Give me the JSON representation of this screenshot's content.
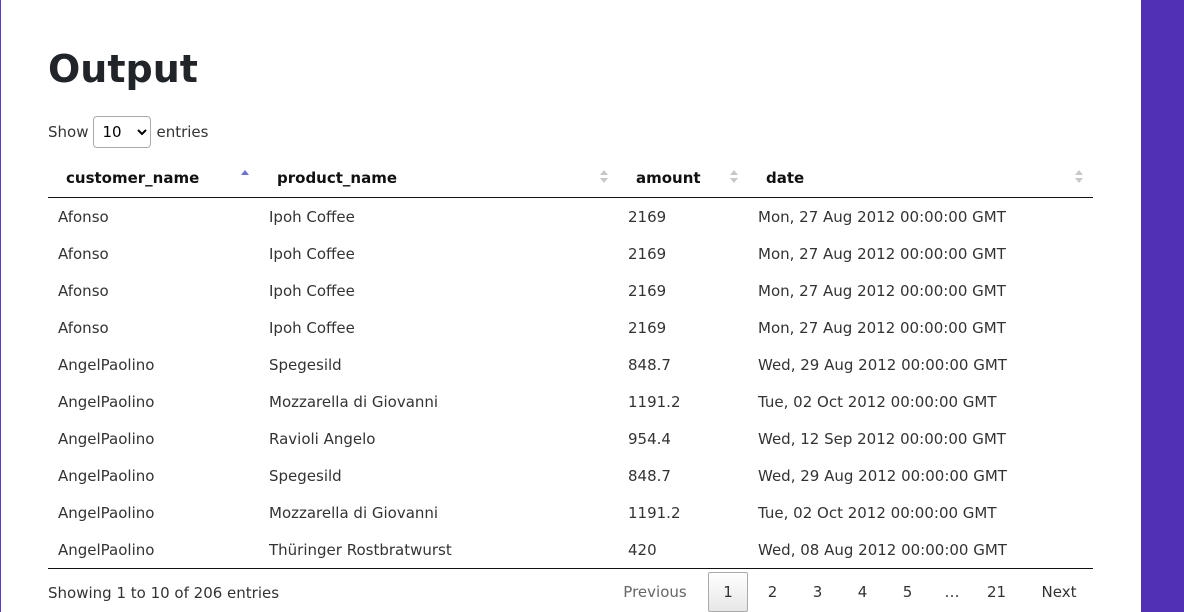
{
  "title": "Output",
  "length_menu": {
    "label_before": "Show",
    "selected": "10",
    "label_after": "entries"
  },
  "columns": [
    "customer_name",
    "product_name",
    "amount",
    "date"
  ],
  "rows": [
    [
      "Afonso",
      "Ipoh Coffee",
      "2169",
      "Mon, 27 Aug 2012 00:00:00 GMT"
    ],
    [
      "Afonso",
      "Ipoh Coffee",
      "2169",
      "Mon, 27 Aug 2012 00:00:00 GMT"
    ],
    [
      "Afonso",
      "Ipoh Coffee",
      "2169",
      "Mon, 27 Aug 2012 00:00:00 GMT"
    ],
    [
      "Afonso",
      "Ipoh Coffee",
      "2169",
      "Mon, 27 Aug 2012 00:00:00 GMT"
    ],
    [
      "AngelPaolino",
      "Spegesild",
      "848.7",
      "Wed, 29 Aug 2012 00:00:00 GMT"
    ],
    [
      "AngelPaolino",
      "Mozzarella di Giovanni",
      "1191.2",
      "Tue, 02 Oct 2012 00:00:00 GMT"
    ],
    [
      "AngelPaolino",
      "Ravioli Angelo",
      "954.4",
      "Wed, 12 Sep 2012 00:00:00 GMT"
    ],
    [
      "AngelPaolino",
      "Spegesild",
      "848.7",
      "Wed, 29 Aug 2012 00:00:00 GMT"
    ],
    [
      "AngelPaolino",
      "Mozzarella di Giovanni",
      "1191.2",
      "Tue, 02 Oct 2012 00:00:00 GMT"
    ],
    [
      "AngelPaolino",
      "Thüringer Rostbratwurst",
      "420",
      "Wed, 08 Aug 2012 00:00:00 GMT"
    ]
  ],
  "info": "Showing 1 to 10 of 206 entries",
  "pagination": {
    "previous": "Previous",
    "pages": [
      "1",
      "2",
      "3",
      "4",
      "5"
    ],
    "ellipsis": "…",
    "last": "21",
    "next": "Next"
  },
  "colors": {
    "accent": "#5130b5",
    "sort_active": "#6b6fd6"
  }
}
